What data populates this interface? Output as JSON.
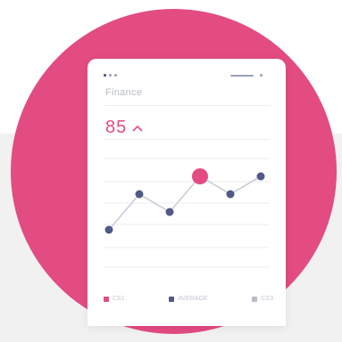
{
  "card": {
    "label": "Finance",
    "metric_value": "85"
  },
  "icons": {
    "window_dots": "window-dots-icon",
    "menu": "menu-icon",
    "trend": "caret-up-icon"
  },
  "colors": {
    "accent": "#e34b83",
    "point": "#4f5a86",
    "line": "#c9cddb"
  },
  "chart_data": {
    "type": "line",
    "x": [
      1,
      2,
      3,
      4,
      5,
      6
    ],
    "values": [
      1,
      3,
      2,
      4,
      3,
      4
    ],
    "highlight_index": 3,
    "ylim": [
      0,
      5
    ],
    "grid": true
  },
  "legend": [
    {
      "label": "CS1",
      "color": "#e34b83"
    },
    {
      "label": "AVERAGE",
      "color": "#4f5a86"
    },
    {
      "label": "CS3",
      "color": "#b8bcc9"
    }
  ]
}
